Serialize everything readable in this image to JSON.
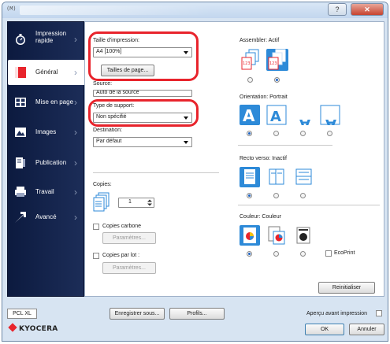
{
  "window": {
    "app_glyph": "(M)",
    "help_label": "?",
    "close_label": "✕"
  },
  "sidebar": {
    "items": [
      {
        "label": "Impression rapide",
        "icon": "stopwatch-icon"
      },
      {
        "label": "Général",
        "icon": "general-icon"
      },
      {
        "label": "Mise en page",
        "icon": "layout-grid-icon"
      },
      {
        "label": "Images",
        "icon": "image-icon"
      },
      {
        "label": "Publication",
        "icon": "publication-icon"
      },
      {
        "label": "Travail",
        "icon": "printer-job-icon"
      },
      {
        "label": "Avancé",
        "icon": "advanced-arrow-icon"
      }
    ]
  },
  "general": {
    "print_size_label": "Taille d'impression:",
    "print_size_value": "A4  [100%]",
    "page_sizes_button": "Tailles de page...",
    "source_label": "Source:",
    "source_value": "Auto de la source",
    "media_label": "Type de support:",
    "media_value": "Non spécifié",
    "destination_label": "Destination:",
    "destination_value": "Par défaut",
    "copies_label": "Copies:",
    "copies_value": "1",
    "carbon_copies_label": "Copies carbone",
    "carbon_params_button": "Paramètres...",
    "copies_by_batch_label": "Copies par lot :",
    "batch_params_button": "Paramètres...",
    "collate_label": "Assembler: Actif",
    "collate_icon_a": "123",
    "collate_icon_b": "123",
    "orientation_label": "Orientation: Portrait",
    "duplex_label": "Recto verso: Inactif",
    "color_label": "Couleur: Couleur",
    "ecoprint_label": "EcoPrint",
    "reset_button": "Reinitialiser"
  },
  "footer": {
    "pcl_label": "PCL XL",
    "save_as_button": "Enregistrer sous...",
    "profiles_button": "Profils...",
    "preview_label": "Aperçu avant impression",
    "ok_button": "OK",
    "cancel_button": "Annuler",
    "brand": "KYOCERA"
  },
  "colors": {
    "sidebar_bg": "#0c1a3f",
    "highlight_ring": "#e8242c",
    "selection_blue": "#2d8ad8",
    "general_tab_red": "#e8242c"
  }
}
